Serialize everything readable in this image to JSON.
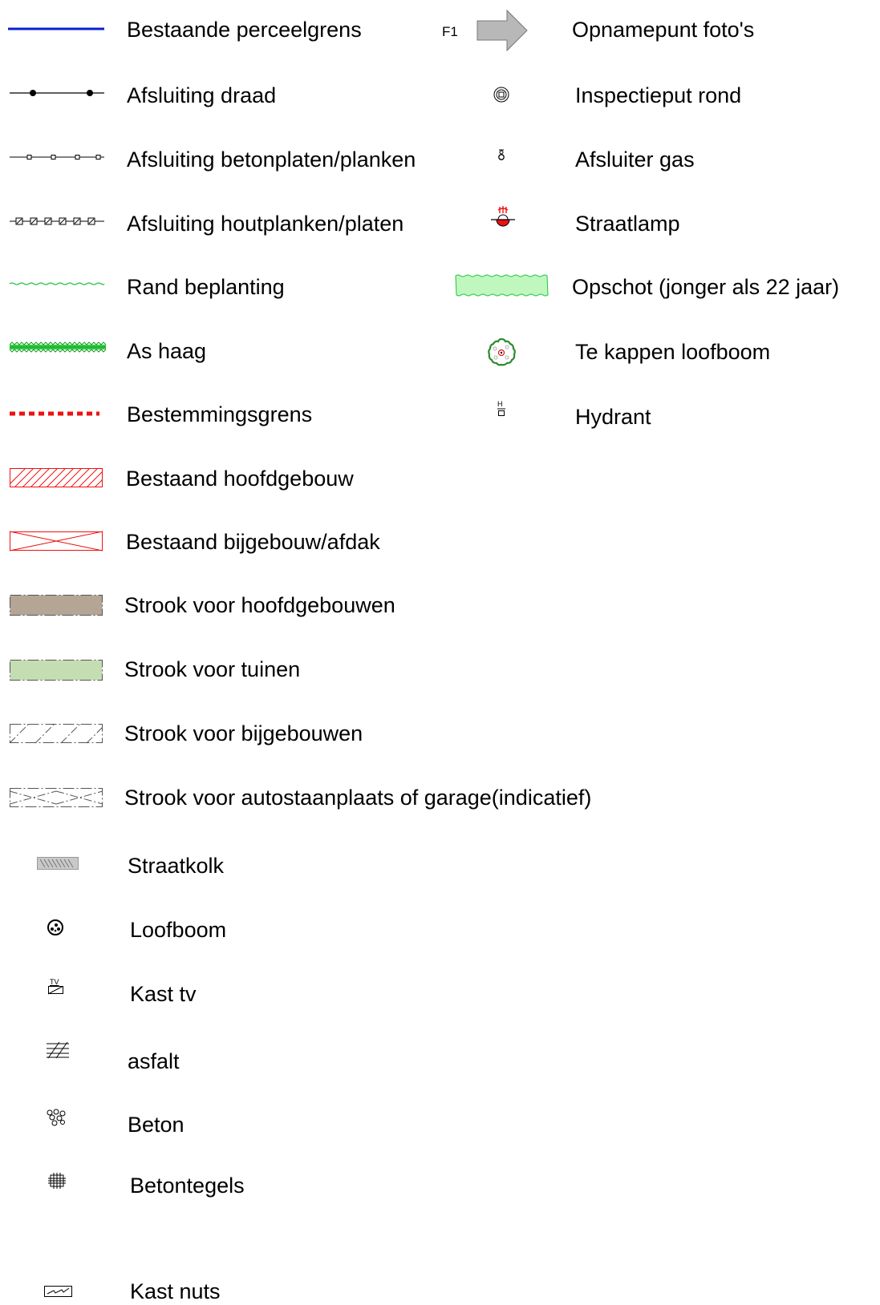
{
  "legend": {
    "left": [
      {
        "key": "perceelgrens",
        "label": "Bestaande perceelgrens",
        "icon": "blue-line-icon"
      },
      {
        "key": "draad",
        "label": "Afsluiting draad",
        "icon": "wire-fence-icon"
      },
      {
        "key": "betonplaten",
        "label": "Afsluiting betonplaten/planken",
        "icon": "concrete-fence-icon"
      },
      {
        "key": "houtplanken",
        "label": "Afsluiting houtplanken/platen",
        "icon": "wood-fence-icon"
      },
      {
        "key": "rand",
        "label": "Rand beplanting",
        "icon": "planting-edge-icon"
      },
      {
        "key": "haag",
        "label": "As haag",
        "icon": "hedge-icon"
      },
      {
        "key": "bestemming",
        "label": "Bestemmingsgrens",
        "icon": "zoning-boundary-icon"
      },
      {
        "key": "hoofdgebouw",
        "label": "Bestaand hoofdgebouw",
        "icon": "hatched-building-icon"
      },
      {
        "key": "bijgebouw",
        "label": "Bestaand bijgebouw/afdak",
        "icon": "crossed-building-icon"
      },
      {
        "key": "strook_hoofd",
        "label": "Strook voor hoofdgebouwen",
        "icon": "main-building-strip-icon"
      },
      {
        "key": "strook_tuin",
        "label": "Strook voor tuinen",
        "icon": "garden-strip-icon"
      },
      {
        "key": "strook_bij",
        "label": "Strook voor bijgebouwen",
        "icon": "annex-strip-icon"
      },
      {
        "key": "strook_auto",
        "label": "Strook voor autostaanplaats of garage(indicatief)",
        "icon": "parking-strip-icon"
      },
      {
        "key": "straatkolk",
        "label": "Straatkolk",
        "icon": "gully-icon"
      },
      {
        "key": "loofboom",
        "label": "Loofboom",
        "icon": "deciduous-tree-icon"
      },
      {
        "key": "kasttv",
        "label": "Kast tv",
        "icon": "tv-cabinet-icon"
      },
      {
        "key": "asfalt",
        "label": "asfalt",
        "icon": "asphalt-icon"
      },
      {
        "key": "beton",
        "label": "Beton",
        "icon": "concrete-icon"
      },
      {
        "key": "betontegels",
        "label": "Betontegels",
        "icon": "concrete-tiles-icon"
      },
      {
        "key": "kastnuts",
        "label": "Kast nuts",
        "icon": "utility-cabinet-icon"
      }
    ],
    "right": [
      {
        "key": "foto",
        "label": "Opnamepunt  foto's",
        "icon": "photo-arrow-icon"
      },
      {
        "key": "put",
        "label": "Inspectieput rond",
        "icon": "manhole-icon"
      },
      {
        "key": "gas",
        "label": "Afsluiter gas",
        "icon": "gas-valve-icon"
      },
      {
        "key": "lamp",
        "label": "Straatlamp",
        "icon": "street-lamp-icon"
      },
      {
        "key": "opschot",
        "label": "Opschot (jonger als 22 jaar)",
        "icon": "young-growth-icon"
      },
      {
        "key": "kappen",
        "label": "Te kappen loofboom",
        "icon": "tree-to-fell-icon"
      },
      {
        "key": "hydrant",
        "label": "Hydrant",
        "icon": "hydrant-icon"
      }
    ],
    "photo_point_code": "F1",
    "hydrant_code": "H",
    "tv_code": "TV"
  },
  "colors": {
    "boundary_blue": "#0a1fd6",
    "red": "#ee1111",
    "green_line": "#21c33a",
    "hedge_green": "#2fd13f",
    "brown_fill": "#b4a595",
    "garden_fill": "#c5ddb3",
    "young_growth_fill": "#bff7bf",
    "arrow_grey": "#b8b8b8"
  }
}
